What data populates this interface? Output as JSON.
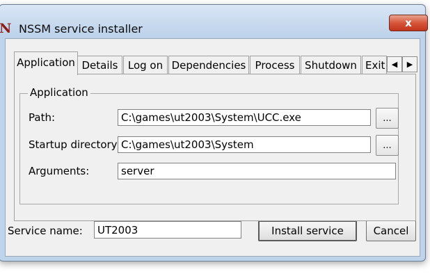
{
  "window": {
    "title": "NSSM service installer",
    "logo_letter": "N",
    "close_glyph": "x"
  },
  "tabs": [
    {
      "label": "Application",
      "selected": true
    },
    {
      "label": "Details",
      "selected": false
    },
    {
      "label": "Log on",
      "selected": false
    },
    {
      "label": "Dependencies",
      "selected": false
    },
    {
      "label": "Process",
      "selected": false
    },
    {
      "label": "Shutdown",
      "selected": false
    },
    {
      "label": "Exit",
      "selected": false
    }
  ],
  "tab_scroll": {
    "left_glyph": "◀",
    "right_glyph": "▶"
  },
  "application_group": {
    "title": "Application",
    "path_label": "Path:",
    "path_value": "C:\\games\\ut2003\\System\\UCC.exe",
    "startup_label": "Startup directory:",
    "startup_value": "C:\\games\\ut2003\\System",
    "arguments_label": "Arguments:",
    "arguments_value": "server",
    "browse_label": "..."
  },
  "footer": {
    "service_name_label": "Service name:",
    "service_name_value": "UT2003",
    "install_label": "Install service",
    "cancel_label": "Cancel"
  },
  "colors": {
    "logo": "#8c1c16",
    "close_button": "#c9452c",
    "frame": "#bfd3ea"
  }
}
